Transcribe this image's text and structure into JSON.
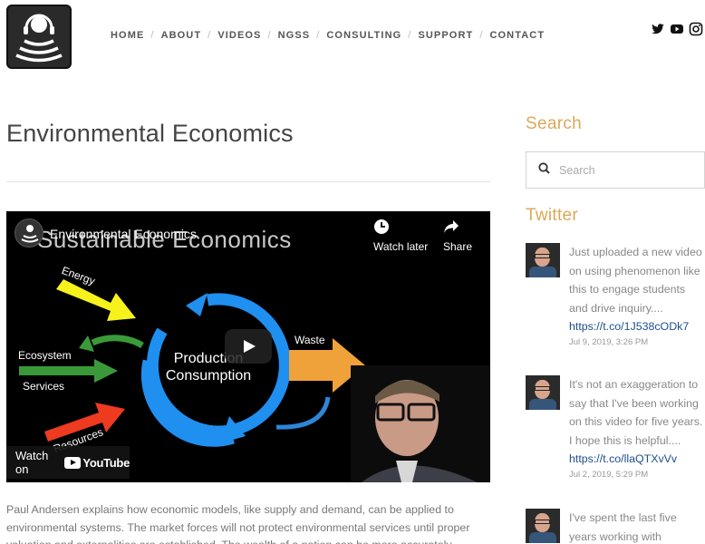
{
  "header": {
    "nav": [
      "HOME",
      "ABOUT",
      "VIDEOS",
      "NGSS",
      "CONSULTING",
      "SUPPORT",
      "CONTACT"
    ],
    "social_icons": [
      "twitter-icon",
      "youtube-icon",
      "instagram-icon"
    ]
  },
  "main": {
    "page_title": "Environmental Economics",
    "video": {
      "title": "Environmental Economics",
      "slide_title": "Sustainable Economics",
      "watch_later": "Watch later",
      "share": "Share",
      "watch_on": "Watch on",
      "youtube": "YouTube",
      "labels": {
        "energy": "Energy",
        "ecosystem": "Ecosystem",
        "services": "Services",
        "resources": "Resources",
        "production": "Production",
        "consumption": "Consumption",
        "waste": "Waste"
      }
    },
    "description": "Paul Andersen explains how economic models, like supply and demand, can be applied to environmental systems. The market forces will not protect environmental services until proper valuation and externalities are established. The wealth of a nation can be more accurately"
  },
  "sidebar": {
    "search_heading": "Search",
    "search_placeholder": "Search",
    "twitter_heading": "Twitter",
    "tweets": [
      {
        "text": "Just uploaded a new video on using phenomenon like this to engage students and drive inquiry....",
        "link": "https://t.co/1J538cODk7",
        "date": "Jul 9, 2019, 3:26 PM"
      },
      {
        "text": "It's not an exaggeration to say that I've been working on this video for five years. I hope this is helpful....",
        "link": "https://t.co/llaQTXvVv",
        "date": "Jul 2, 2019, 5:29 PM"
      },
      {
        "text": "I've spent the last five years working with",
        "link": "",
        "date": ""
      }
    ]
  },
  "colors": {
    "accent": "#dba85a",
    "link": "#1e4e8c",
    "arrow_yellow": "#f7f21c",
    "arrow_green": "#3a9a3a",
    "arrow_red": "#ee3a1f",
    "arrow_orange": "#f0a23a",
    "cycle_blue": "#1f8ff0"
  }
}
